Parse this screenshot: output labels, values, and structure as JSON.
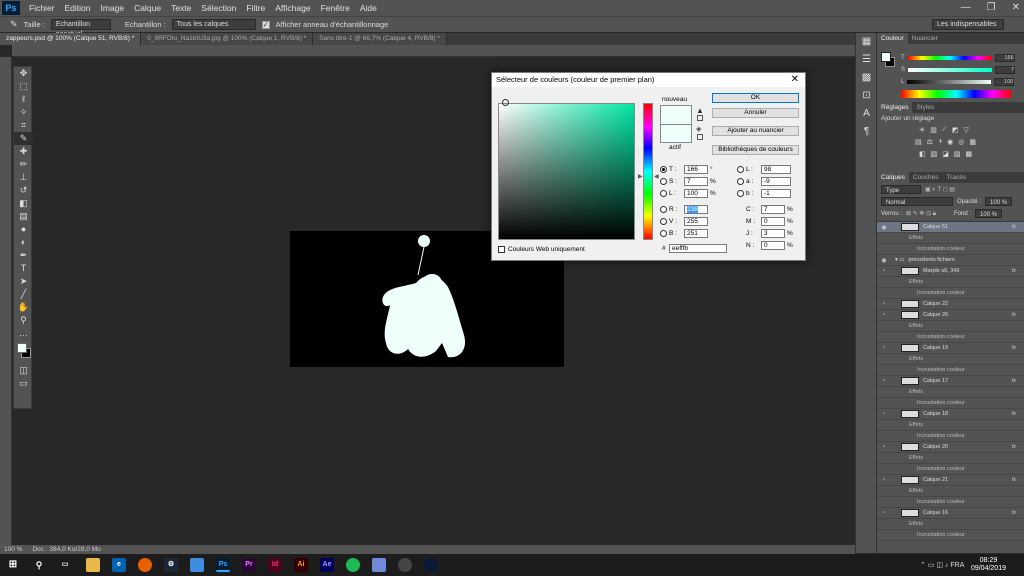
{
  "app": {
    "logo": "Ps"
  },
  "menu": [
    "Fichier",
    "Edition",
    "Image",
    "Calque",
    "Texte",
    "Sélection",
    "Filtre",
    "Affichage",
    "Fenêtre",
    "Aide"
  ],
  "window_controls": {
    "minimize": "—",
    "maximize": "❐",
    "close": "✕"
  },
  "options": {
    "taille_label": "Taille :",
    "taille_value": "Echantillon ponctuel",
    "echantillon_label": "Echantillon :",
    "echantillon_value": "Tous les calques",
    "ring_label": "Afficher anneau d'échantillonnage",
    "workspace": "Les indispensables"
  },
  "tabs": [
    "zappeurs.psd @ 100% (Calque 51, RVB/8) *",
    "0_9RFOIu_Na1bIU3a.jpg @ 100% (Calque 1, RVB/8) *",
    "Sans titre-1 @ 66,7% (Calque 4, RVB/8) *"
  ],
  "status": {
    "zoom": "100 %",
    "doc": "Doc : 384,0 Ko/28,0 Mo"
  },
  "color_panel": {
    "tabs": [
      "Couleur",
      "Nuancier"
    ],
    "values": [
      "166",
      "7",
      "100"
    ]
  },
  "adjust_panel": {
    "tabs": [
      "Réglages",
      "Styles"
    ],
    "title": "Ajouter un réglage"
  },
  "layers_panel": {
    "tabs": [
      "Calques",
      "Couches",
      "Tracés"
    ],
    "filter": "Type",
    "blend": "Normal",
    "opacity_label": "Opacité :",
    "opacity": "100 %",
    "lock_label": "Verrou :",
    "fill_label": "Fond :",
    "fill": "100 %",
    "rows": [
      {
        "kind": "layer",
        "name": "Calque 51",
        "fx": "fx",
        "selected": true
      },
      {
        "kind": "sub",
        "name": "Effets"
      },
      {
        "kind": "subsub",
        "name": "Incrustation couleur"
      },
      {
        "kind": "group",
        "name": "precedents fichiers"
      },
      {
        "kind": "layer",
        "name": "Marple s6, 349",
        "fx": "fx"
      },
      {
        "kind": "sub",
        "name": "Effets"
      },
      {
        "kind": "subsub",
        "name": "Incrustation couleur"
      },
      {
        "kind": "layer",
        "name": "Calque 22",
        "fx": ""
      },
      {
        "kind": "layer",
        "name": "Calque 26",
        "fx": "fx"
      },
      {
        "kind": "sub",
        "name": "Effets"
      },
      {
        "kind": "subsub",
        "name": "Incrustation couleur"
      },
      {
        "kind": "layer",
        "name": "Calque 19",
        "fx": "fx"
      },
      {
        "kind": "sub",
        "name": "Effets"
      },
      {
        "kind": "subsub",
        "name": "Incrustation couleur"
      },
      {
        "kind": "layer",
        "name": "Calque 17",
        "fx": "fx"
      },
      {
        "kind": "sub",
        "name": "Effets"
      },
      {
        "kind": "subsub",
        "name": "Incrustation couleur"
      },
      {
        "kind": "layer",
        "name": "Calque 18",
        "fx": "fx"
      },
      {
        "kind": "sub",
        "name": "Effets"
      },
      {
        "kind": "subsub",
        "name": "Incrustation couleur"
      },
      {
        "kind": "layer",
        "name": "Calque 20",
        "fx": "fx"
      },
      {
        "kind": "sub",
        "name": "Effets"
      },
      {
        "kind": "subsub",
        "name": "Incrustation couleur"
      },
      {
        "kind": "layer",
        "name": "Calque 21",
        "fx": "fx"
      },
      {
        "kind": "sub",
        "name": "Effets"
      },
      {
        "kind": "subsub",
        "name": "Incrustation couleur"
      },
      {
        "kind": "layer",
        "name": "Calque 16",
        "fx": "fx"
      },
      {
        "kind": "sub",
        "name": "Effets"
      },
      {
        "kind": "subsub",
        "name": "Incrustation couleur"
      }
    ]
  },
  "dialog": {
    "title": "Sélecteur de couleurs (couleur de premier plan)",
    "close": "✕",
    "nouveau": "nouveau",
    "actif": "actif",
    "ok": "OK",
    "annuler": "Annuler",
    "ajouter": "Ajouter au nuancier",
    "biblio": "Bibliothèques de couleurs",
    "web_only": "Couleurs Web uniquement",
    "fields": {
      "T": {
        "label": "T :",
        "value": "166",
        "unit": "°"
      },
      "S": {
        "label": "S :",
        "value": "7",
        "unit": "%"
      },
      "Lum": {
        "label": "L :",
        "value": "100",
        "unit": "%"
      },
      "R": {
        "label": "R :",
        "value": "238"
      },
      "V": {
        "label": "V :",
        "value": "255"
      },
      "B": {
        "label": "B :",
        "value": "251"
      },
      "L": {
        "label": "L :",
        "value": "98"
      },
      "a": {
        "label": "a :",
        "value": "-9"
      },
      "b": {
        "label": "b :",
        "value": "-1"
      },
      "C": {
        "label": "C :",
        "value": "7",
        "unit": "%"
      },
      "M": {
        "label": "M :",
        "value": "0",
        "unit": "%"
      },
      "J": {
        "label": "J :",
        "value": "3",
        "unit": "%"
      },
      "N": {
        "label": "N :",
        "value": "0",
        "unit": "%"
      }
    },
    "hex_label": "#",
    "hex": "eefffb",
    "new_color": "#eefffb",
    "hue_color": "#00e6a4"
  },
  "taskbar": {
    "apps": [
      "Ps",
      "Pr",
      "Id",
      "Ai",
      "Ae"
    ],
    "time": "08:29",
    "date": "09/04/2019"
  }
}
